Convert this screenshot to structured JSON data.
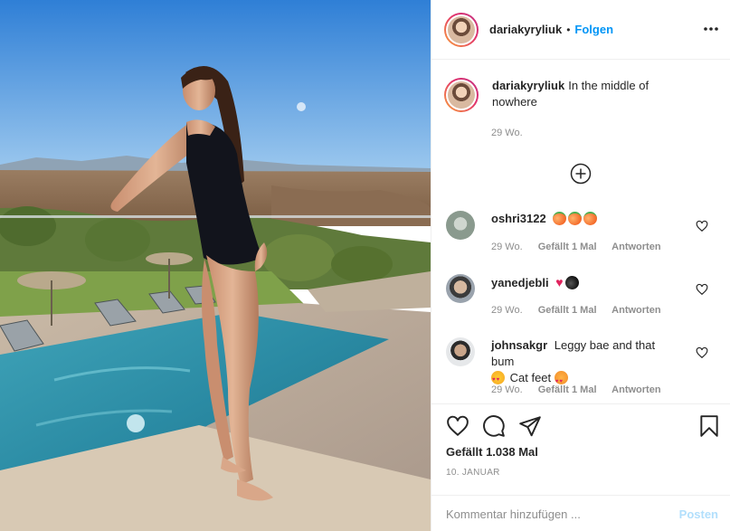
{
  "post": {
    "username": "dariakyryliuk",
    "follow_label": "Folgen",
    "separator": "•",
    "more_icon": "more-horizontal-icon"
  },
  "caption": {
    "username": "dariakyryliuk",
    "text": "In the middle of nowhere",
    "time": "29 Wo."
  },
  "load_more_icon": "plus-circle-icon",
  "comments": [
    {
      "username": "oshri3122",
      "text": "",
      "emojis": [
        "peach",
        "peach",
        "peach"
      ],
      "time": "29 Wo.",
      "likes": "Gefällt 1 Mal",
      "reply": "Antworten"
    },
    {
      "username": "yanedjebli",
      "text": "",
      "emojis": [
        "heart",
        "bomb"
      ],
      "time": "29 Wo.",
      "likes": "Gefällt 1 Mal",
      "reply": "Antworten"
    },
    {
      "username": "johnsakgr",
      "text_1": "Leggy bae and that bum",
      "text_2": "Cat feet",
      "emojis": [
        "heart-eyes",
        "cat-heart-eyes"
      ],
      "time": "29 Wo.",
      "likes": "Gefällt 1 Mal",
      "reply": "Antworten"
    }
  ],
  "actions": {
    "like_icon": "heart-icon",
    "comment_icon": "comment-icon",
    "share_icon": "paper-plane-icon",
    "save_icon": "bookmark-icon",
    "likes_text": "Gefällt 1.038 Mal",
    "date": "10. JANUAR"
  },
  "comment_box": {
    "placeholder": "Kommentar hinzufügen ...",
    "post_label": "Posten"
  },
  "colors": {
    "link_blue": "#0095f6",
    "post_disabled": "#b2dffc",
    "muted": "#8e8e8e",
    "text": "#262626"
  }
}
